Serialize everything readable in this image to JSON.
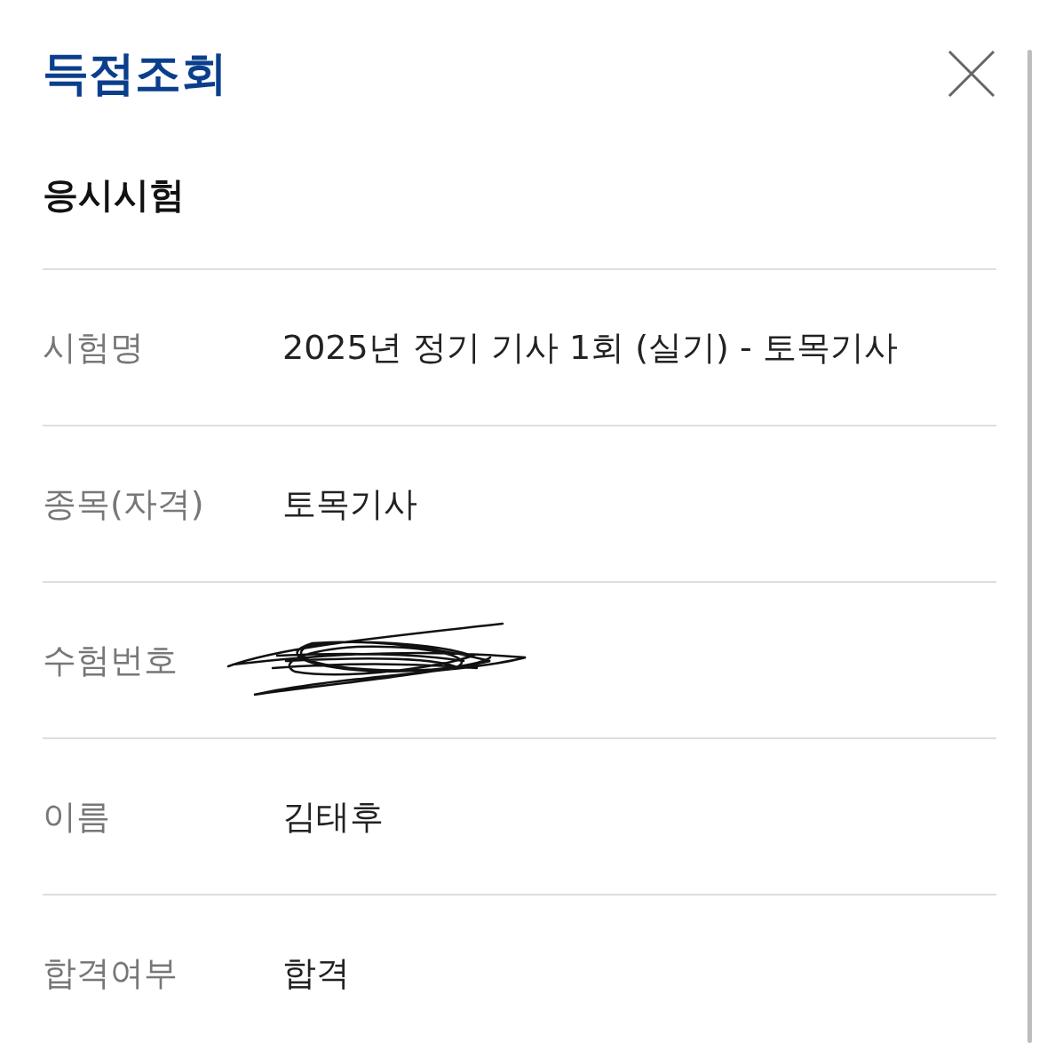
{
  "header": {
    "title": "득점조회"
  },
  "section": {
    "title": "응시시험"
  },
  "rows": [
    {
      "label": "시험명",
      "kind": "text",
      "value": "2025년 정기 기사 1회 (실기) - 토목기사"
    },
    {
      "label": "종목(자격)",
      "kind": "text",
      "value": "토목기사"
    },
    {
      "label": "수험번호",
      "kind": "redacted"
    },
    {
      "label": "이름",
      "kind": "text",
      "value": "김태후"
    },
    {
      "label": "합격여부",
      "kind": "text",
      "value": "합격"
    }
  ]
}
